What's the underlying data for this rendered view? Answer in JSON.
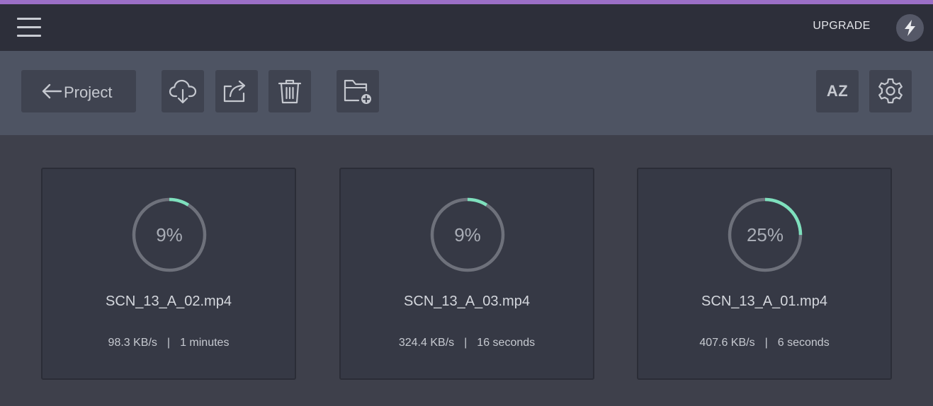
{
  "header": {
    "upgrade_label": "UPGRADE"
  },
  "toolbar": {
    "back_label": "Project",
    "sort_label": "AZ"
  },
  "colors": {
    "accent": "#9b6fc6",
    "progress": "#7ee0bd",
    "track": "#6e717b"
  },
  "icons": {
    "menu": "menu-icon",
    "bolt": "bolt-icon",
    "back": "arrow-left-icon",
    "download": "cloud-download-icon",
    "share": "share-icon",
    "delete": "trash-icon",
    "new_folder": "folder-add-icon",
    "settings": "gear-icon"
  },
  "uploads": [
    {
      "percent": 9,
      "percent_label": "9%",
      "filename": "SCN_13_A_02.mp4",
      "speed": "98.3 KB/s",
      "eta": "1 minutes"
    },
    {
      "percent": 9,
      "percent_label": "9%",
      "filename": "SCN_13_A_03.mp4",
      "speed": "324.4 KB/s",
      "eta": "16 seconds"
    },
    {
      "percent": 25,
      "percent_label": "25%",
      "filename": "SCN_13_A_01.mp4",
      "speed": "407.6 KB/s",
      "eta": "6 seconds"
    }
  ]
}
